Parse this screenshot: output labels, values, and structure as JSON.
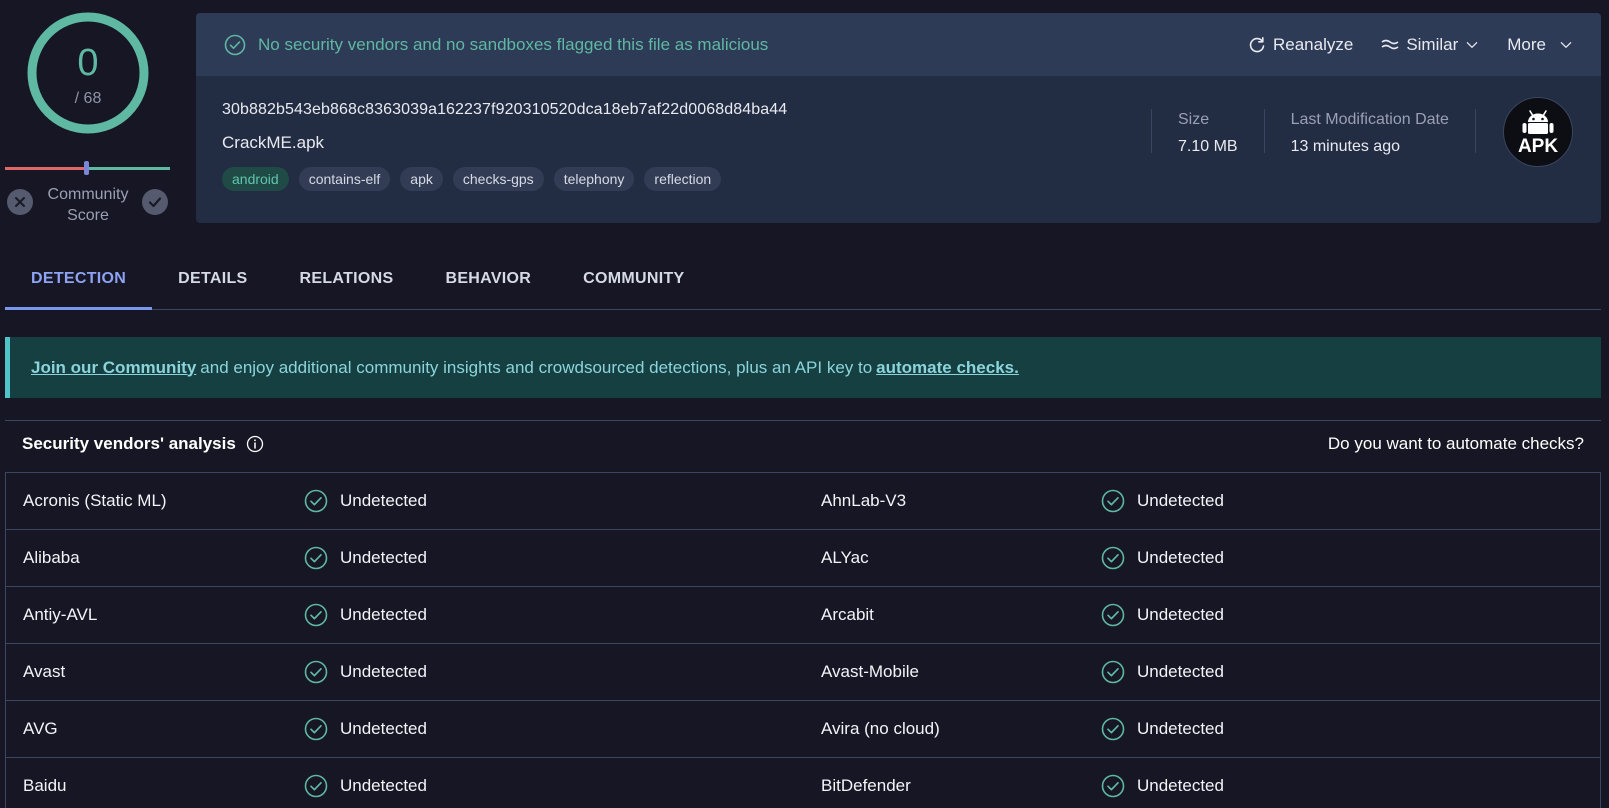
{
  "score": {
    "detections": "0",
    "total": "/ 68",
    "community_label_line1": "Community",
    "community_label_line2": "Score"
  },
  "verdict": {
    "text": "No security vendors and no sandboxes flagged this file as malicious",
    "color": "#5fb8a2"
  },
  "actions": {
    "reanalyze": "Reanalyze",
    "similar": "Similar",
    "more": "More"
  },
  "file": {
    "hash": "30b882b543eb868c8363039a162237f920310520dca18eb7af22d0068d84ba44",
    "name": "CrackME.apk",
    "tags": [
      "android",
      "contains-elf",
      "apk",
      "checks-gps",
      "telephony",
      "reflection"
    ],
    "size_label": "Size",
    "size_value": "7.10 MB",
    "modified_label": "Last Modification Date",
    "modified_value": "13 minutes ago",
    "type_badge": "APK"
  },
  "tabs": [
    "DETECTION",
    "DETAILS",
    "RELATIONS",
    "BEHAVIOR",
    "COMMUNITY"
  ],
  "banner": {
    "link1": "Join our Community",
    "middle": "and enjoy additional community insights and crowdsourced detections, plus an API key to",
    "link2": "automate checks."
  },
  "vendor_analysis": {
    "title": "Security vendors' analysis",
    "cta": "Do you want to automate checks?",
    "rows": [
      [
        {
          "vendor": "Acronis (Static ML)",
          "result": "Undetected"
        },
        {
          "vendor": "AhnLab-V3",
          "result": "Undetected"
        }
      ],
      [
        {
          "vendor": "Alibaba",
          "result": "Undetected"
        },
        {
          "vendor": "ALYac",
          "result": "Undetected"
        }
      ],
      [
        {
          "vendor": "Antiy-AVL",
          "result": "Undetected"
        },
        {
          "vendor": "Arcabit",
          "result": "Undetected"
        }
      ],
      [
        {
          "vendor": "Avast",
          "result": "Undetected"
        },
        {
          "vendor": "Avast-Mobile",
          "result": "Undetected"
        }
      ],
      [
        {
          "vendor": "AVG",
          "result": "Undetected"
        },
        {
          "vendor": "Avira (no cloud)",
          "result": "Undetected"
        }
      ],
      [
        {
          "vendor": "Baidu",
          "result": "Undetected"
        },
        {
          "vendor": "BitDefender",
          "result": "Undetected"
        }
      ]
    ]
  },
  "colors": {
    "accent_green": "#5fb8a2",
    "accent_blue": "#8ea3f4",
    "background": "#161624"
  }
}
